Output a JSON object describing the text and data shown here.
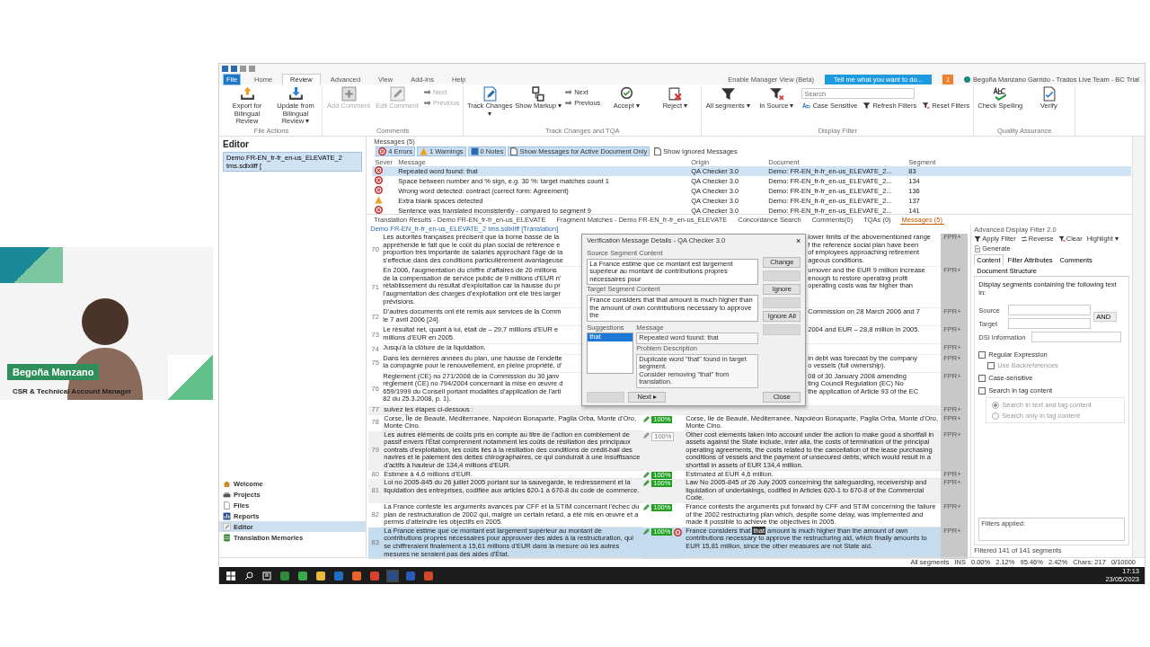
{
  "presenter": {
    "name": "Begoña Manzano",
    "role": "CSR & Technical Account Manager"
  },
  "ribbon_tabs": [
    {
      "label": "File",
      "kind": "file",
      "selected": false
    },
    {
      "label": "Home",
      "kind": "tab",
      "selected": false
    },
    {
      "label": "Review",
      "kind": "tab",
      "selected": true
    },
    {
      "label": "Advanced",
      "kind": "tab",
      "selected": false
    },
    {
      "label": "View",
      "kind": "tab",
      "selected": false
    },
    {
      "label": "Add-Ins",
      "kind": "tab",
      "selected": false
    },
    {
      "label": "Help",
      "kind": "tab",
      "selected": false
    }
  ],
  "ribbon_right": {
    "manager_view": "Enable Manager View (Beta)",
    "tell_me": "Tell me what you want to do...",
    "notifications": "1",
    "user": "Begoña Manzano Garrido - Trados Live Team - BC Trial"
  },
  "ribbon_groups": [
    {
      "label": "File Actions",
      "items": [
        {
          "kind": "large",
          "label": "Export for Bilingual Review",
          "disabled": false
        },
        {
          "kind": "large",
          "label": "Update from Bilingual Review ▾",
          "disabled": false
        }
      ]
    },
    {
      "label": "Comments",
      "items": [
        {
          "kind": "large",
          "label": "Add Comment",
          "disabled": true
        },
        {
          "kind": "large",
          "label": "Edit Comment",
          "disabled": true
        },
        {
          "kind": "stack",
          "items": [
            {
              "kind": "small",
              "label": "Next",
              "disabled": true
            },
            {
              "kind": "small",
              "label": "Previous",
              "disabled": true
            }
          ]
        }
      ]
    },
    {
      "label": "Track Changes and TQA",
      "items": [
        {
          "kind": "large",
          "label": "Track Changes ▾",
          "disabled": false
        },
        {
          "kind": "large",
          "label": "Show Markup ▾",
          "disabled": false
        },
        {
          "kind": "stack",
          "items": [
            {
              "kind": "small",
              "label": "Next",
              "disabled": false
            },
            {
              "kind": "small",
              "label": "Previous",
              "disabled": false
            }
          ]
        },
        {
          "kind": "large",
          "label": "Accept ▾",
          "disabled": false
        },
        {
          "kind": "large",
          "label": "Reject ▾",
          "disabled": false
        }
      ]
    },
    {
      "label": "Display Filter",
      "items": [
        {
          "kind": "large",
          "label": "All segments ▾",
          "disabled": false
        },
        {
          "kind": "large",
          "label": "In Source ▾",
          "disabled": false
        },
        {
          "kind": "stack",
          "items": [
            {
              "kind": "search",
              "placeholder": "Search"
            },
            {
              "kind": "row",
              "items": [
                {
                  "kind": "small",
                  "label": "Case Sensitive",
                  "disabled": false
                },
                {
                  "kind": "small",
                  "label": "Refresh Filters",
                  "disabled": false
                },
                {
                  "kind": "small",
                  "label": "Reset Filters",
                  "disabled": false
                }
              ]
            }
          ]
        }
      ]
    },
    {
      "label": "Quality Assurance",
      "items": [
        {
          "kind": "large",
          "label": "Check Spelling",
          "disabled": false
        },
        {
          "kind": "large",
          "label": "Verify",
          "disabled": false
        }
      ]
    }
  ],
  "editor_panel": {
    "title": "Editor",
    "files": [
      {
        "label": "Demo FR-EN_fr-fr_en-us_ELEVATE_2 tms.sdlxliff [",
        "selected": true
      }
    ],
    "views": [
      {
        "label": "Welcome",
        "selected": false
      },
      {
        "label": "Projects",
        "selected": false
      },
      {
        "label": "Files",
        "selected": false
      },
      {
        "label": "Reports",
        "selected": false
      },
      {
        "label": "Editor",
        "selected": true
      },
      {
        "label": "Translation Memories",
        "selected": false
      }
    ]
  },
  "messages": {
    "title": "Messages (5)",
    "filters": [
      {
        "kind": "error",
        "label": "4 Errors",
        "selected": true
      },
      {
        "kind": "warning",
        "label": "1 Warnings",
        "selected": true
      },
      {
        "kind": "note",
        "label": "0 Notes",
        "selected": true
      },
      {
        "kind": "toggle",
        "label": "Show Messages for Active Document Only",
        "selected": true
      },
      {
        "kind": "toggle",
        "label": "Show Ignored Messages",
        "selected": false
      }
    ],
    "columns": [
      "Sever",
      "Message",
      "Origin",
      "Document",
      "Segment"
    ],
    "rows": [
      {
        "kind": "error",
        "message": "Repeated word found: that",
        "origin": "QA Checker 3.0",
        "document": "Demo: FR-EN_fr-fr_en-us_ELEVATE_2...",
        "segment": "83",
        "selected": true
      },
      {
        "kind": "error",
        "message": "Space between number and % sign, e.g. 30 %: target matches count 1",
        "origin": "QA Checker 3.0",
        "document": "Demo: FR-EN_fr-fr_en-us_ELEVATE_2...",
        "segment": "134",
        "selected": false
      },
      {
        "kind": "error",
        "message": "Wrong word detected: contract (correct form: Agreement)",
        "origin": "QA Checker 3.0",
        "document": "Demo: FR-EN_fr-fr_en-us_ELEVATE_2...",
        "segment": "136",
        "selected": false
      },
      {
        "kind": "warning",
        "message": "Extra blank spaces detected",
        "origin": "QA Checker 3.0",
        "document": "Demo: FR-EN_fr-fr_en-us_ELEVATE_2...",
        "segment": "137",
        "selected": false
      },
      {
        "kind": "error",
        "message": "Sentence was translated inconsistently - compared to segment 9",
        "origin": "QA Checker 3.0",
        "document": "Demo: FR-EN_fr-fr_en-us_ELEVATE_2...",
        "segment": "141",
        "selected": false
      }
    ]
  },
  "panel_tabs": [
    {
      "label": "Translation Results - Demo FR-EN_fr-fr_en-us_ELEVATE",
      "selected": false
    },
    {
      "label": "Fragment Matches - Demo FR-EN_fr-fr_en-us_ELEVATE",
      "selected": false
    },
    {
      "label": "Concordance Search",
      "selected": false
    },
    {
      "label": "Comments(0)",
      "selected": false
    },
    {
      "label": "TQAs (0)",
      "selected": false
    },
    {
      "label": "Messages (5)",
      "selected": true
    }
  ],
  "editor": {
    "doc_tab": "Demo FR-EN_fr-fr_en-us_ELEVATE_2 tms.sdlxliff [Translation]",
    "covered_segments": [
      {
        "number": "70",
        "source": "Les autorités françaises précisent que la borne basse de la\nappréhende le fait que le coût du plan social de référence e\nproportion très importante de salariés approchant l'âge de la\ns'effectue dans des conditions particulièrement avantageuse",
        "target": "lower limits of the abovementioned range\nf the reference social plan have been\nof employees approaching retirement\nageous conditions.",
        "fpr": "FPR+"
      },
      {
        "number": "71",
        "source": "En 2006, l'augmentation du chiffre d'affaires de 20 millions\nde la compensation de service public de 9 millions d'EUR n'\nrétablissement du résultat d'exploitation car la hausse du pr\nl'augmentation des charges d'exploitation ont été très larger\nprévisions.",
        "target": "urnover and the EUR 9 million increase\nenough to restore operating profit\noperating costs was far higher than",
        "fpr": "FPR+"
      },
      {
        "number": "72",
        "source": "D'autres documents ont été remis aux services de la Comm\nle 7 avril 2006 [24].",
        "target": "Commission on 28 March 2006 and 7",
        "fpr": "FPR+"
      },
      {
        "number": "73",
        "source": "Le résultat net, quant à lui, était de – 29,7 millions d'EUR e\nmillions d'EUR en 2005.",
        "target": "2004 and EUR – 28,8 million in 2005.",
        "fpr": "FPR+"
      },
      {
        "number": "74",
        "source": "Jusqu'à la clôture de la liquidation.",
        "fpr": "FPR+"
      },
      {
        "number": "75",
        "source": "Dans les dernières années du plan, une hausse de l'endette\nla compagnie pour le renouvellement, en pleine propriété, d'",
        "target": "in debt was forecast by the company\no vessels (full ownership).",
        "fpr": "FPR+"
      },
      {
        "number": "76",
        "source": "Règlement (CE) no 271/2008 de la Commission du 30 janv\nrèglement (CE) no 794/2004 concernant la mise en œuvre d\n659/1999 du Conseil portant modalités d'application de l'arti\n82 du 25.3.2008, p. 1).",
        "target": "08 of 30 January 2008 amending\nting Council Regulation (EC) No\nthe application of Article 93 of the EC",
        "fpr": "FPR+"
      }
    ],
    "segments": [
      {
        "number": "77",
        "source": "suivez les étapes ci-dessous :",
        "kind": "none",
        "fpr": "FPR+",
        "error": false,
        "selected": false
      },
      {
        "number": "78",
        "source": "Corse, Île de Beauté, Méditerranée, Napoléon Bonaparte, Paglia Orba, Monte d'Oro, Monte Cino.",
        "kind": "confirmed",
        "match": "100%",
        "target": "Corse, Ile de Beauté, Méditerranée, Napoléon Bonaparte, Paglia Orba, Monte d'Oro, Monte Cino.",
        "fpr": "FPR+",
        "error": false,
        "selected": false
      },
      {
        "number": "79",
        "source": "Les autres éléments de coûts pris en compte au titre de l'action en comblement de passif envers l'État comprennent notamment les coûts de résiliation des principaux contrats d'exploitation, les coûts liés à la résiliation des conditions de crédit-bail des navires et le paiement des dettes chirographaires, ce qui conduirait à une insuffisance d'actifs à hauteur de 134,4 millions d'EUR.",
        "kind": "draft",
        "match": "100%",
        "target": "Other cost elements taken into account under the action to make good a shortfall in assets against the State include, inter alia, the costs of termination of the principal operating agreements, the costs related to the cancellation of the lease purchasing conditions of vessels and the payment of unsecured debts, which would result in a shortfall in assets of EUR 134,4 million.",
        "fpr": "FPR+",
        "error": false,
        "selected": false
      },
      {
        "number": "80",
        "source": "Estimée à 4,6 millions d'EUR.",
        "kind": "confirmed",
        "match": "100%",
        "target": "Estimated at EUR 4,6 million.",
        "fpr": "FPR+",
        "error": false,
        "selected": false
      },
      {
        "number": "81",
        "source": "Loi no 2005-845 du 26 juillet 2005 portant sur la sauvegarde, le redressement et la liquidation des entreprises, codifiée aux articles 620-1 à 670-8 du code de commerce.",
        "kind": "confirmed",
        "match": "100%",
        "target": "Law No 2005-845 of 26 July 2005 concerning the safeguarding, receivership and liquidation of undertakings, codified in Articles 620-1 to 670-8 of the Commercial Code.",
        "fpr": "FPR+",
        "error": false,
        "selected": false
      },
      {
        "number": "82",
        "source": "La France conteste les arguments avancés par CFF et la STIM concernant l'échec du plan de restructuration de 2002 qui, malgré un certain retard, a été mis en œuvre et a permis d'atteindre les objectifs en 2005.",
        "kind": "confirmed",
        "match": "100%",
        "target": "France contests the arguments put forward by CFF and STIM concerning the failure of the 2002 restructuring plan which, despite some delay, was implemented and made it possible to achieve the objectives in 2005.",
        "fpr": "FPR+",
        "error": false,
        "selected": false
      },
      {
        "number": "83",
        "source": "La France estime que ce montant est largement supérieur au montant de contributions propres nécessaires pour approuver des aides à la restructuration, qui se chiffreraient finalement à 15,61 millions d'EUR dans la mesure où les autres mesures ne seraient pas des aides d'État.",
        "kind": "confirmed",
        "match": "100%",
        "target": "France considers that **that** amount is much higher than the amount of own contributions necessary to approve the restructuring aid, which finally amounts to EUR 15,81 million, since the other measures are not State aid.",
        "fpr": "FPR+",
        "error": true,
        "selected": true
      }
    ]
  },
  "dialog": {
    "title": "Verification Message Details - QA Checker 3.0",
    "close_icon": "×",
    "source_label": "Source Segment Content",
    "source_text": "La France estime que ce montant est largement supérieur au montant de contributions propres nécessaires pour",
    "target_label": "Target Segment Content",
    "target_text": "France considers that that amount is much higher than the amount of own contributions necessary to approve the",
    "side_buttons": [
      {
        "label": "Change",
        "disabled": false
      },
      {
        "disabled": true
      },
      {
        "label": "Ignore",
        "disabled": false
      },
      {
        "disabled": true
      },
      {
        "label": "Ignore All",
        "disabled": false
      },
      {
        "disabled": true
      }
    ],
    "suggestions_label": "Suggestions",
    "suggestions": [
      {
        "label": "that",
        "selected": true
      }
    ],
    "message_label": "Message",
    "message": "Repeated word found: that",
    "problem_label": "Problem Description",
    "problem": "Duplicate word \"that\" found in target segment.\nConsider removing \"that\" from translation.",
    "bottom_buttons": [
      {
        "disabled": true
      },
      {
        "label": "Next ▸",
        "disabled": false
      }
    ],
    "close": "Close"
  },
  "filter_panel": {
    "title": "Advanced Display Filter 2.0",
    "toolbar": [
      "Apply Filter",
      "Reverse",
      "Clear",
      "Highlight ▾",
      "Generate"
    ],
    "tabs": [
      {
        "label": "Content",
        "selected": true
      },
      {
        "label": "Filter Attributes",
        "selected": false
      },
      {
        "label": "Comments",
        "selected": false
      },
      {
        "label": "Document Structure",
        "selected": false
      }
    ],
    "intro": "Display segments containing the following text in:",
    "fields": [
      {
        "label": "Source"
      },
      {
        "label": "Target"
      }
    ],
    "operator": "AND",
    "dsi_label": "DSI Information",
    "options": [
      {
        "kind": "checkbox",
        "label": "Regular Expression",
        "checked": false,
        "disabled": false,
        "children": [
          {
            "kind": "checkbox",
            "label": "Use Backreferences",
            "checked": false,
            "disabled": true
          }
        ]
      },
      {
        "kind": "checkbox",
        "label": "Case-sensitive",
        "checked": false,
        "disabled": false
      },
      {
        "kind": "checkbox",
        "label": "Search in tag content",
        "checked": false,
        "disabled": false,
        "children": [
          {
            "kind": "radio",
            "label": "Search in text and tag content",
            "selected": true,
            "disabled": true
          },
          {
            "kind": "radio",
            "label": "Search only in tag content",
            "selected": false,
            "disabled": true
          }
        ]
      }
    ],
    "filters_applied": "Filters applied:",
    "filtered": "Filtered 141 of 141 segments"
  },
  "status_bar": [
    "All segments",
    "INS",
    "0.00%",
    "2.12%",
    "95.46%",
    "2.42%",
    "Chars: 217",
    "0/10000"
  ],
  "taskbar": {
    "apps": [
      {
        "kind": "start",
        "selected": false
      },
      {
        "kind": "search",
        "selected": false
      },
      {
        "kind": "task-view",
        "selected": false
      },
      {
        "kind": "app",
        "color": "#2e8b3e",
        "selected": false
      },
      {
        "kind": "app",
        "color": "#3aa84a",
        "selected": false
      },
      {
        "kind": "app",
        "color": "#e8b93a",
        "selected": false
      },
      {
        "kind": "app",
        "color": "#1e6fc4",
        "selected": false
      },
      {
        "kind": "app",
        "color": "#e8642a",
        "selected": false
      },
      {
        "kind": "app",
        "color": "#d9412f",
        "selected": false
      },
      {
        "kind": "app",
        "color": "#2a4d8f",
        "selected": true
      },
      {
        "kind": "app",
        "color": "#2b5ab8",
        "selected": false
      },
      {
        "kind": "app",
        "color": "#d24726",
        "selected": false
      }
    ],
    "time": "17:13",
    "date": "23/05/2023"
  }
}
